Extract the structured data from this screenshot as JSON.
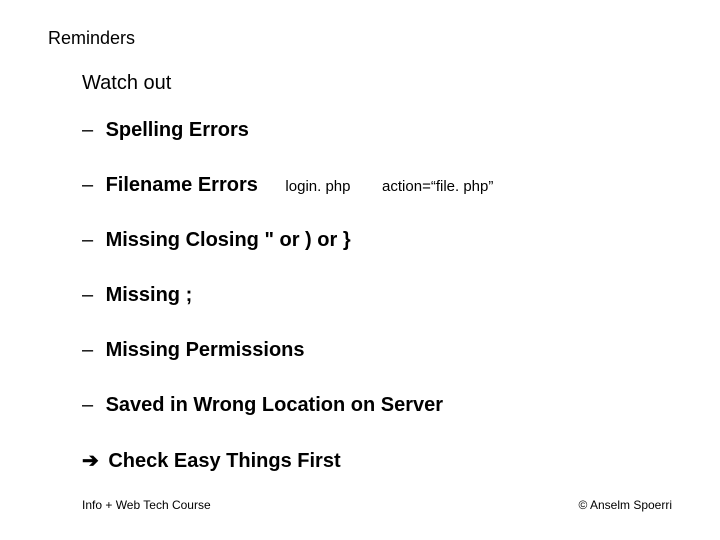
{
  "title": "Reminders",
  "subtitle": "Watch out",
  "bullets": {
    "b1": {
      "label": "Spelling Errors"
    },
    "b2": {
      "label": "Filename Errors",
      "d1": "login. php",
      "d2": "action=“file. php”"
    },
    "b3": {
      "label": "Missing Closing \" or ) or }"
    },
    "b4": {
      "label": "Missing ;"
    },
    "b5": {
      "label": "Missing Permissions"
    },
    "b6": {
      "label": "Saved in Wrong Location on Server"
    }
  },
  "conclusion": {
    "arrow": "➔",
    "text": "Check Easy Things First"
  },
  "footer": {
    "left": "Info + Web Tech Course",
    "right": "© Anselm Spoerri"
  },
  "dash": "–"
}
